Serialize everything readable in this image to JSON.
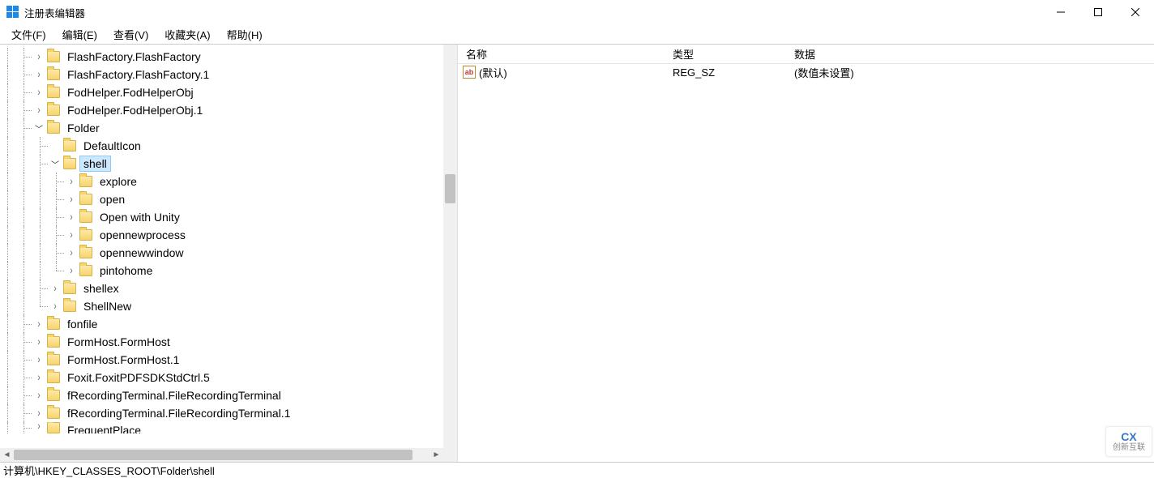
{
  "window": {
    "title": "注册表编辑器"
  },
  "menu": {
    "file": "文件(F)",
    "edit": "编辑(E)",
    "view": "查看(V)",
    "favorites": "收藏夹(A)",
    "help": "帮助(H)"
  },
  "tree": {
    "selected": "shell",
    "nodes": [
      {
        "indent": 2,
        "exp": "closed",
        "label": "FlashFactory.FlashFactory"
      },
      {
        "indent": 2,
        "exp": "closed",
        "label": "FlashFactory.FlashFactory.1"
      },
      {
        "indent": 2,
        "exp": "closed",
        "label": "FodHelper.FodHelperObj"
      },
      {
        "indent": 2,
        "exp": "closed",
        "label": "FodHelper.FodHelperObj.1"
      },
      {
        "indent": 2,
        "exp": "open",
        "label": "Folder"
      },
      {
        "indent": 3,
        "exp": "none",
        "label": "DefaultIcon"
      },
      {
        "indent": 3,
        "exp": "open",
        "label": "shell",
        "selected": true
      },
      {
        "indent": 4,
        "exp": "closed",
        "label": "explore"
      },
      {
        "indent": 4,
        "exp": "closed",
        "label": "open"
      },
      {
        "indent": 4,
        "exp": "closed",
        "label": "Open with Unity"
      },
      {
        "indent": 4,
        "exp": "closed",
        "label": "opennewprocess"
      },
      {
        "indent": 4,
        "exp": "closed",
        "label": "opennewwindow"
      },
      {
        "indent": 4,
        "exp": "closed",
        "label": "pintohome",
        "last": true
      },
      {
        "indent": 3,
        "exp": "closed",
        "label": "shellex"
      },
      {
        "indent": 3,
        "exp": "closed",
        "label": "ShellNew",
        "last": true
      },
      {
        "indent": 2,
        "exp": "closed",
        "label": "fonfile"
      },
      {
        "indent": 2,
        "exp": "closed",
        "label": "FormHost.FormHost"
      },
      {
        "indent": 2,
        "exp": "closed",
        "label": "FormHost.FormHost.1"
      },
      {
        "indent": 2,
        "exp": "closed",
        "label": "Foxit.FoxitPDFSDKStdCtrl.5"
      },
      {
        "indent": 2,
        "exp": "closed",
        "label": "fRecordingTerminal.FileRecordingTerminal"
      },
      {
        "indent": 2,
        "exp": "closed",
        "label": "fRecordingTerminal.FileRecordingTerminal.1"
      },
      {
        "indent": 2,
        "exp": "closed",
        "label": "FrequentPlace",
        "cut": true
      }
    ]
  },
  "list": {
    "columns": {
      "name": "名称",
      "type": "类型",
      "data": "数据"
    },
    "rows": [
      {
        "icon": "ab",
        "name": "(默认)",
        "type": "REG_SZ",
        "data": "(数值未设置)"
      }
    ]
  },
  "statusbar": {
    "path": "计算机\\HKEY_CLASSES_ROOT\\Folder\\shell"
  },
  "watermark": {
    "logo": "CX",
    "text": "创新互联"
  }
}
